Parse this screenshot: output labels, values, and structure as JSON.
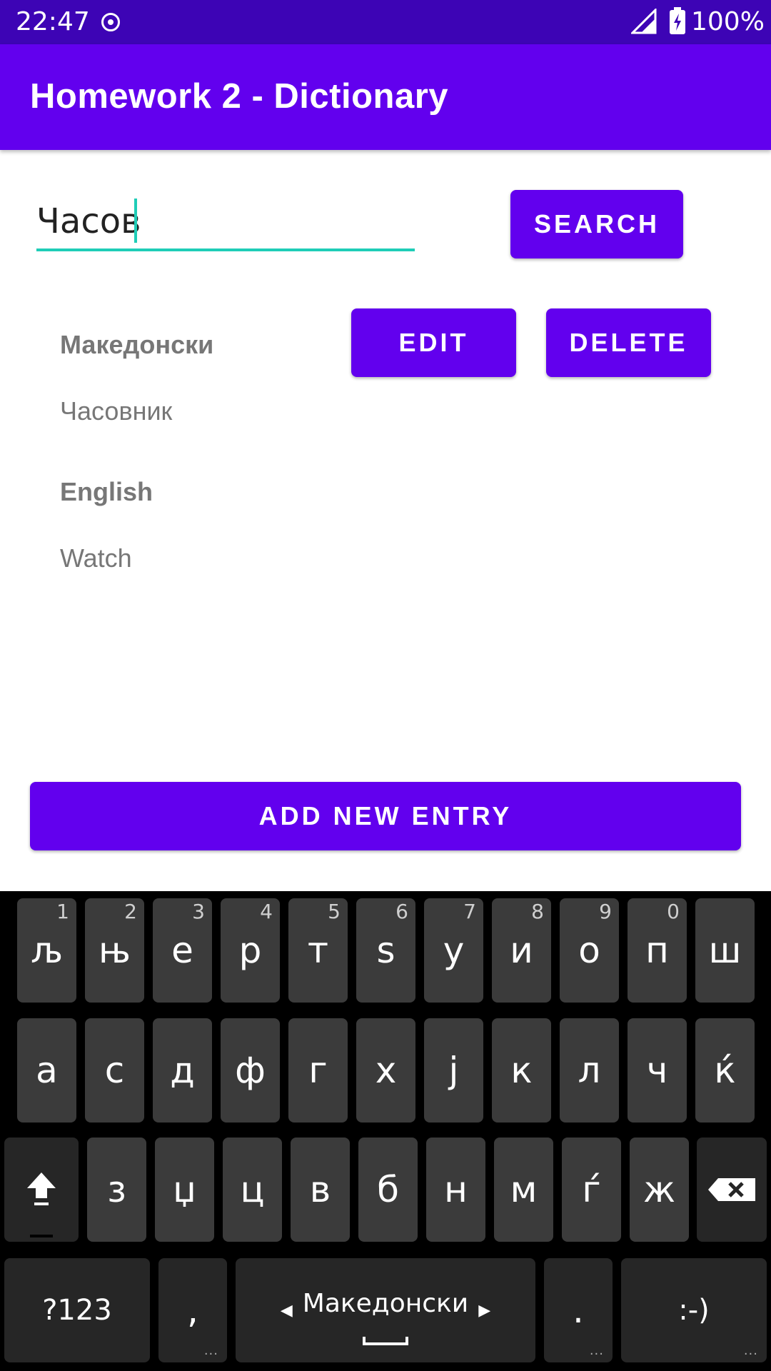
{
  "status_bar": {
    "time": "22:47",
    "battery": "100%"
  },
  "app_bar": {
    "title": "Homework 2 - Dictionary"
  },
  "search": {
    "value": "Часов",
    "button_label": "SEARCH"
  },
  "entry": {
    "edit_label": "EDIT",
    "delete_label": "DELETE",
    "lang1_heading": "Македонски",
    "lang1_value": "Часовник",
    "lang2_heading": "English",
    "lang2_value": "Watch"
  },
  "add_button_label": "ADD NEW ENTRY",
  "keyboard": {
    "row1": [
      {
        "k": "љ",
        "h": "1"
      },
      {
        "k": "њ",
        "h": "2"
      },
      {
        "k": "е",
        "h": "3"
      },
      {
        "k": "р",
        "h": "4"
      },
      {
        "k": "т",
        "h": "5"
      },
      {
        "k": "ѕ",
        "h": "6"
      },
      {
        "k": "у",
        "h": "7"
      },
      {
        "k": "и",
        "h": "8"
      },
      {
        "k": "о",
        "h": "9"
      },
      {
        "k": "п",
        "h": "0"
      },
      {
        "k": "ш",
        "h": ""
      }
    ],
    "row2": [
      "а",
      "с",
      "д",
      "ф",
      "г",
      "х",
      "ј",
      "к",
      "л",
      "ч",
      "ќ"
    ],
    "row3": [
      "з",
      "џ",
      "ц",
      "в",
      "б",
      "н",
      "м",
      "ѓ",
      "ж"
    ],
    "symbols_label": "?123",
    "comma_label": ",",
    "space_label": "Македонски",
    "period_label": ".",
    "emoji_label": ":-)"
  }
}
